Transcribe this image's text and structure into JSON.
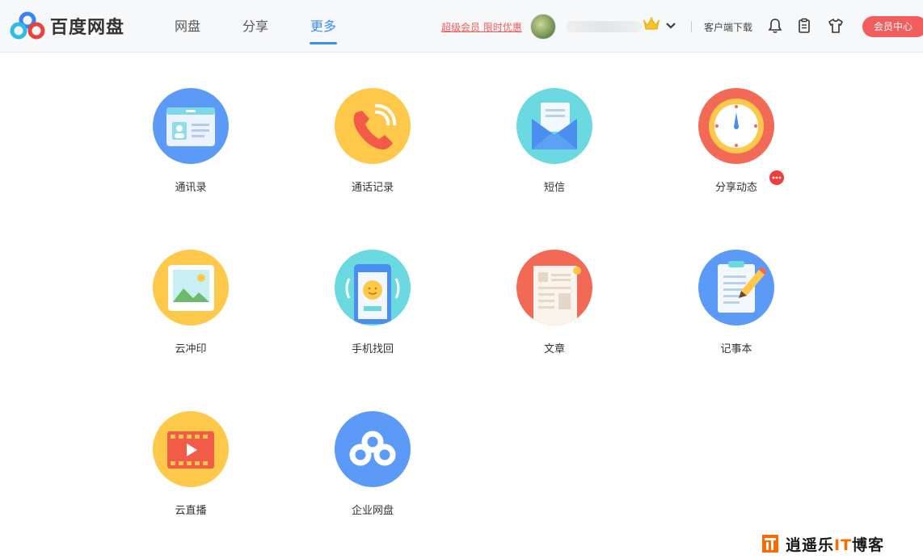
{
  "header": {
    "logo_text": "百度网盘",
    "nav": [
      {
        "label": "网盘",
        "active": false
      },
      {
        "label": "分享",
        "active": false
      },
      {
        "label": "更多",
        "active": true
      }
    ],
    "promo": "超级会员 限时优惠",
    "client_download": "客户端下载",
    "vip_center": "会员中心"
  },
  "apps": [
    {
      "label": "通讯录",
      "icon": "contacts-icon",
      "color": "#5b9af6"
    },
    {
      "label": "通话记录",
      "icon": "phone-call-icon",
      "color": "#fec94b"
    },
    {
      "label": "短信",
      "icon": "envelope-icon",
      "color": "#6ad9e0"
    },
    {
      "label": "分享动态",
      "icon": "clock-icon",
      "color": "#f26a55",
      "has_badge": true
    },
    {
      "label": "云冲印",
      "icon": "photo-print-icon",
      "color": "#fec94b"
    },
    {
      "label": "手机找回",
      "icon": "phone-find-icon",
      "color": "#6ad9e0"
    },
    {
      "label": "文章",
      "icon": "article-icon",
      "color": "#f26a55"
    },
    {
      "label": "记事本",
      "icon": "notepad-icon",
      "color": "#5b9af6"
    },
    {
      "label": "云直播",
      "icon": "video-icon",
      "color": "#fec94b"
    },
    {
      "label": "企业网盘",
      "icon": "baidu-cloud-icon",
      "color": "#5b9af6"
    }
  ],
  "watermark": {
    "prefix": "逍遥乐",
    "it": "IT",
    "suffix": "博客"
  },
  "colors": {
    "accent": "#3b8cff",
    "promo": "#f25b5b",
    "vip": "#f25d5d"
  }
}
